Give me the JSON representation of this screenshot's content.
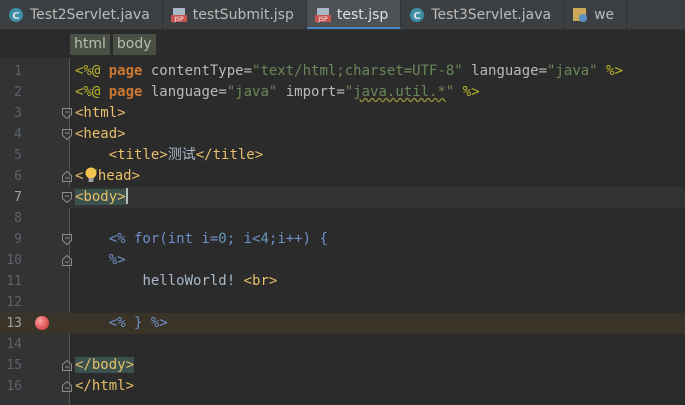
{
  "tabs": [
    {
      "label": "Test2Servlet.java",
      "icon": "java-class-icon"
    },
    {
      "label": "testSubmit.jsp",
      "icon": "jsp-file-icon"
    },
    {
      "label": "test.jsp",
      "icon": "jsp-file-icon",
      "active": true
    },
    {
      "label": "Test3Servlet.java",
      "icon": "java-class-icon"
    },
    {
      "label": "we",
      "icon": "web-xml-icon"
    }
  ],
  "breadcrumb": [
    "html",
    "body"
  ],
  "line_numbers": [
    "1",
    "2",
    "3",
    "4",
    "5",
    "6",
    "7",
    "8",
    "9",
    "10",
    "11",
    "12",
    "13",
    "14",
    "15",
    "16"
  ],
  "code": {
    "l1": {
      "open": "<%@ ",
      "kw": "page",
      "a1": " contentType=",
      "v1": "\"text/html;charset=UTF-8\"",
      "a2": " language=",
      "v2": "\"java\"",
      "close": " %>"
    },
    "l2": {
      "open": "<%@ ",
      "kw": "page",
      "a1": " language=",
      "v1": "\"java\"",
      "a2": " import=",
      "v2q": "\"",
      "v2": "java.util.*",
      "v2e": "\"",
      "close": " %>"
    },
    "l3": "<html>",
    "l4": "<head>",
    "l5": {
      "indent": "    ",
      "open": "<title>",
      "text": "测试",
      "close": "</title>"
    },
    "l6a": "<",
    "l6b": "/head>",
    "l7": "<body>",
    "l9": {
      "indent": "    ",
      "open": "<%",
      "text": " for(int i=",
      "n0": "0",
      "mid": "; i<",
      "n4": "4",
      "end": ";i++) {"
    },
    "l10": {
      "indent": "    ",
      "text": "%>"
    },
    "l11": {
      "indent": "        ",
      "text": "helloWorld! ",
      "tag": "<br>"
    },
    "l13": {
      "indent": "    ",
      "open": "<%",
      "text": " } ",
      "close": "%>"
    },
    "l15": "</body>",
    "l16": "</html>"
  },
  "colors": {
    "background": "#2b2b2b",
    "tag": "#e8bf6a",
    "keyword": "#cc7832",
    "string": "#6a8759",
    "number": "#6897bb",
    "breakpoint": "#e05555",
    "active_tab_underline": "#4a88c7"
  }
}
